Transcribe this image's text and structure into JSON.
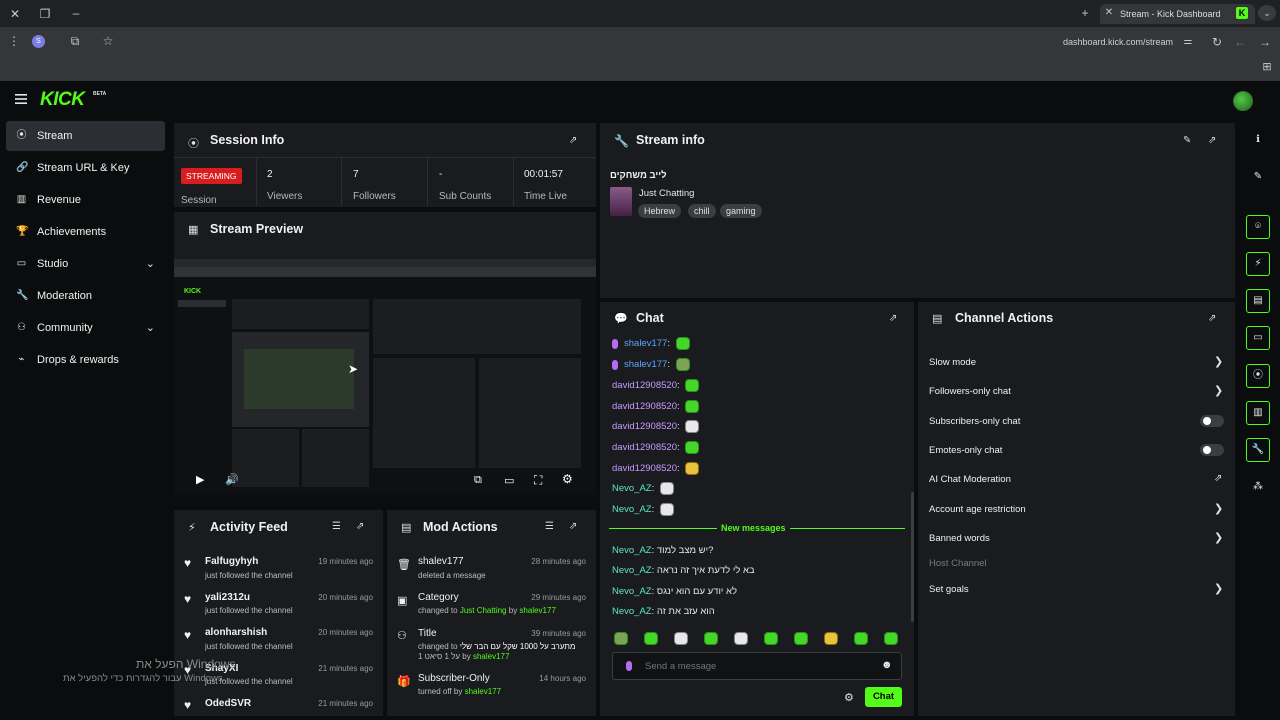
{
  "browser": {
    "tab_title": "Stream - Kick Dashboard",
    "tab_icon_letter": "K",
    "url": "dashboard.kick.com/stream",
    "profile_initial": "S"
  },
  "brand": {
    "logo": "KICK",
    "beta": "BETA",
    "accent": "#53fc18"
  },
  "sidebar": {
    "items": [
      {
        "label": "Stream",
        "icon": "broadcast-icon",
        "active": true
      },
      {
        "label": "Stream URL & Key",
        "icon": "link-icon"
      },
      {
        "label": "Revenue",
        "icon": "chart-icon"
      },
      {
        "label": "Achievements",
        "icon": "trophy-icon"
      },
      {
        "label": "Studio",
        "icon": "studio-icon",
        "expandable": true
      },
      {
        "label": "Moderation",
        "icon": "wrench-icon"
      },
      {
        "label": "Community",
        "icon": "community-icon",
        "expandable": true
      },
      {
        "label": "Drops & rewards",
        "icon": "drops-icon"
      }
    ]
  },
  "session": {
    "title": "Session Info",
    "status": "STREAMING",
    "status_label": "Session",
    "stats": [
      {
        "value": "2",
        "label": "Viewers"
      },
      {
        "value": "7",
        "label": "Followers"
      },
      {
        "value": "-",
        "label": "Sub Counts"
      },
      {
        "value": "00:01:57",
        "label": "Time Live"
      }
    ]
  },
  "preview": {
    "title": "Stream Preview"
  },
  "stream_info": {
    "title": "Stream info",
    "stream_title": "לייב משחקים",
    "category": "Just Chatting",
    "tags": [
      "Hebrew",
      "chill",
      "gaming"
    ]
  },
  "chat": {
    "title": "Chat",
    "messages": [
      {
        "user": "shalev177",
        "color": "blue",
        "mic": true,
        "emote": "g",
        "text": ""
      },
      {
        "user": "shalev177",
        "color": "blue",
        "mic": true,
        "emote": "m",
        "text": ""
      },
      {
        "user": "david12908520",
        "color": "purple",
        "emote": "g",
        "text": ""
      },
      {
        "user": "david12908520",
        "color": "purple",
        "emote": "g",
        "text": ""
      },
      {
        "user": "david12908520",
        "color": "purple",
        "emote": "w",
        "text": ""
      },
      {
        "user": "david12908520",
        "color": "purple",
        "emote": "g",
        "text": ""
      },
      {
        "user": "david12908520",
        "color": "purple",
        "emote": "y",
        "text": ""
      },
      {
        "user": "Nevo_AZ",
        "color": "teal",
        "emote": "w",
        "text": ""
      },
      {
        "user": "Nevo_AZ",
        "color": "teal",
        "emote": "w",
        "text": ""
      }
    ],
    "new_messages_label": "New messages",
    "new_messages": [
      {
        "user": "Nevo_AZ",
        "text": "יש מצב למוד?"
      },
      {
        "user": "Nevo_AZ",
        "text": "בא לי לדעת איך זה נראה"
      },
      {
        "user": "Nevo_AZ",
        "text": "לא יודע עם הוא ינגס"
      },
      {
        "user": "Nevo_AZ",
        "text": "הוא עזב את זה"
      }
    ],
    "placeholder": "Send a message",
    "send_label": "Chat"
  },
  "channel_actions": {
    "title": "Channel Actions",
    "items": [
      {
        "label": "Slow mode",
        "control": "arrow"
      },
      {
        "label": "Followers-only chat",
        "control": "arrow"
      },
      {
        "label": "Subscribers-only chat",
        "control": "toggle",
        "on": false
      },
      {
        "label": "Emotes-only chat",
        "control": "toggle",
        "on": false
      },
      {
        "label": "AI Chat Moderation",
        "control": "external"
      },
      {
        "label": "Account age restriction",
        "control": "arrow"
      },
      {
        "label": "Banned words",
        "control": "arrow"
      },
      {
        "label": "Host Channel",
        "control": "none",
        "disabled": true
      },
      {
        "label": "Set goals",
        "control": "arrow"
      }
    ]
  },
  "activity": {
    "title": "Activity Feed",
    "items": [
      {
        "name": "Falfugyhyh",
        "text": "just followed the channel",
        "time": "19 minutes ago"
      },
      {
        "name": "yali2312u",
        "text": "just followed the channel",
        "time": "20 minutes ago"
      },
      {
        "name": "alonharshish",
        "text": "just followed the channel",
        "time": "20 minutes ago"
      },
      {
        "name": "ShayXI",
        "text": "just followed the channel",
        "time": "21 minutes ago"
      },
      {
        "name": "OdedSVR",
        "text": "",
        "time": "21 minutes ago"
      }
    ]
  },
  "mod_actions": {
    "title": "Mod Actions",
    "items": [
      {
        "name": "shalev177",
        "line1": "deleted a message",
        "time": "28 minutes ago",
        "icon": "trash-icon"
      },
      {
        "name": "Category",
        "line1": "changed to ",
        "hl": "Just Chatting",
        "by": " by ",
        "who": "shalev177",
        "time": "29 minutes ago",
        "icon": "category-icon"
      },
      {
        "name": "Title",
        "line1": "changed to ",
        "hl": "מתערב על 1000 שקל עם הבר שלי",
        "line2": "1 על 1 סיאט by ",
        "who": "shalev177",
        "time": "39 minutes ago",
        "icon": "title-icon"
      },
      {
        "name": "Subscriber-Only",
        "line1": "turned off by ",
        "who": "shalev177",
        "time": "14 hours ago",
        "icon": "gift-icon"
      }
    ]
  },
  "watermark": {
    "line1": "הפעל את Windows",
    "line2": "עבור להגדרות כדי להפעיל את Windows."
  }
}
